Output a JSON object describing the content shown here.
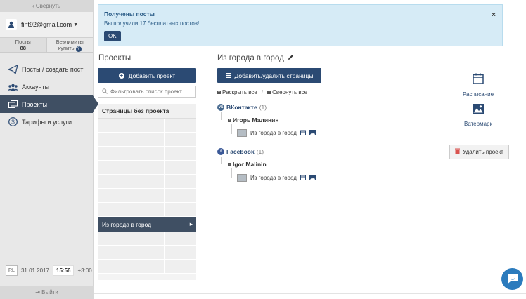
{
  "sidebar": {
    "collapse_label": "Свернуть",
    "email": "fint92@gmail.com",
    "stats": {
      "posts_label": "Посты",
      "posts_value": "88",
      "unlimited_label": "Безлимиты",
      "unlimited_action": "купить"
    },
    "nav": [
      {
        "label": "Посты / создать пост",
        "icon": "paper-plane-icon"
      },
      {
        "label": "Аккаунты",
        "icon": "users-icon"
      },
      {
        "label": "Проекты",
        "icon": "folders-icon"
      },
      {
        "label": "Тарифы и услуги",
        "icon": "dollar-icon"
      }
    ],
    "timezone": "RL",
    "date": "31.01.2017",
    "time": "15:56",
    "offset": "+3:00",
    "logout_label": "Выйти"
  },
  "alert": {
    "title": "Получены посты",
    "text": "Вы получили 17 бесплатных постов!",
    "ok_label": "OK"
  },
  "projects": {
    "title": "Проекты",
    "add_label": "Добавить проект",
    "filter_placeholder": "Фильтровать список проект",
    "list_header": "Страницы без проекта",
    "active_project": "Из города в город"
  },
  "main": {
    "title": "Из города в город",
    "add_pages_label": "Добавить/удалить страницы",
    "expand_all": "Раскрыть все",
    "collapse_all": "Свернуть все",
    "networks": [
      {
        "name": "ВКонтакте",
        "count": "(1)",
        "account": "Игорь Малинин",
        "page": "Из города в город"
      },
      {
        "name": "Facebook",
        "count": "(1)",
        "account": "Igor Malinin",
        "page": "Из города в город"
      }
    ]
  },
  "tools": {
    "schedule_label": "Расписание",
    "watermark_label": "Ватермарк",
    "delete_label": "Удалить проект"
  },
  "colors": {
    "primary": "#2b4a73",
    "active_nav": "#3f4f63",
    "alert_bg": "#d6ebf6",
    "chat": "#2b7bbd"
  }
}
